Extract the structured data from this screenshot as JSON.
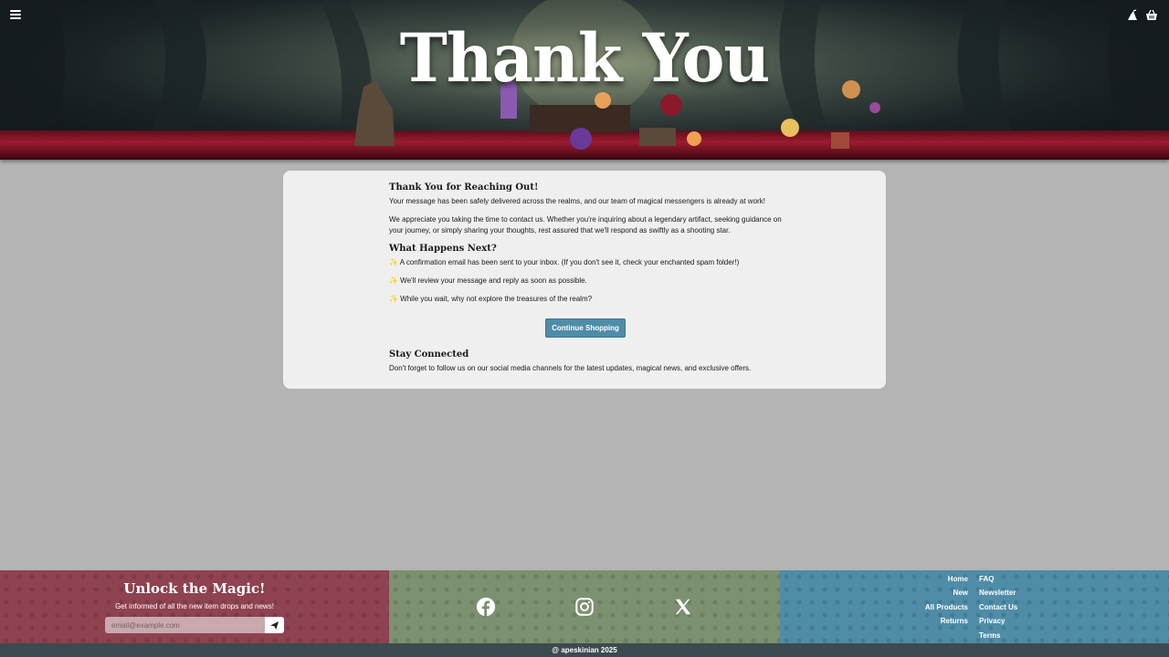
{
  "header": {
    "title": "Thank You",
    "icons": [
      "menu-icon",
      "wizard-hat-icon",
      "basket-icon"
    ]
  },
  "card": {
    "heading": "Thank You for Reaching Out!",
    "p1": "Your message has been safely delivered across the realms, and our team of magical messengers is already at work!",
    "p2": "We appreciate you taking the time to contact us. Whether you're inquiring about a legendary artifact, seeking guidance on your journey, or simply sharing your thoughts, rest assured that we'll respond as swiftly as a shooting star.",
    "next_heading": "What Happens Next?",
    "items": [
      "✨ A confirmation email has been sent to your inbox. (If you don't see it, check your enchanted spam folder!)",
      "✨ We'll review your message and reply as soon as possible.",
      "✨ While you wait, why not explore the treasures of the realm?"
    ],
    "button_label": "Continue Shopping",
    "connect_heading": "Stay Connected",
    "connect_text": "Don't forget to follow us on our social media channels for the latest updates, magical news, and exclusive offers."
  },
  "footer": {
    "newsletter_title": "Unlock the Magic!",
    "newsletter_sub": "Get informed of all the new item drops and news!",
    "email_placeholder": "email@example.com",
    "social": [
      "facebook-icon",
      "instagram-icon",
      "x-icon"
    ],
    "links_left": [
      "Home",
      "New",
      "All Products",
      "Returns"
    ],
    "links_right": [
      "FAQ",
      "Newsletter",
      "Contact Us",
      "Privacy",
      "Terms"
    ],
    "copyright": "@ apeskinian 2025"
  },
  "colors": {
    "newsletter_bg": "#8f4250",
    "social_bg": "#7b9170",
    "links_bg": "#4f8ca8",
    "button": "#4f8ca8",
    "copyright_bg": "#3c4b50"
  }
}
